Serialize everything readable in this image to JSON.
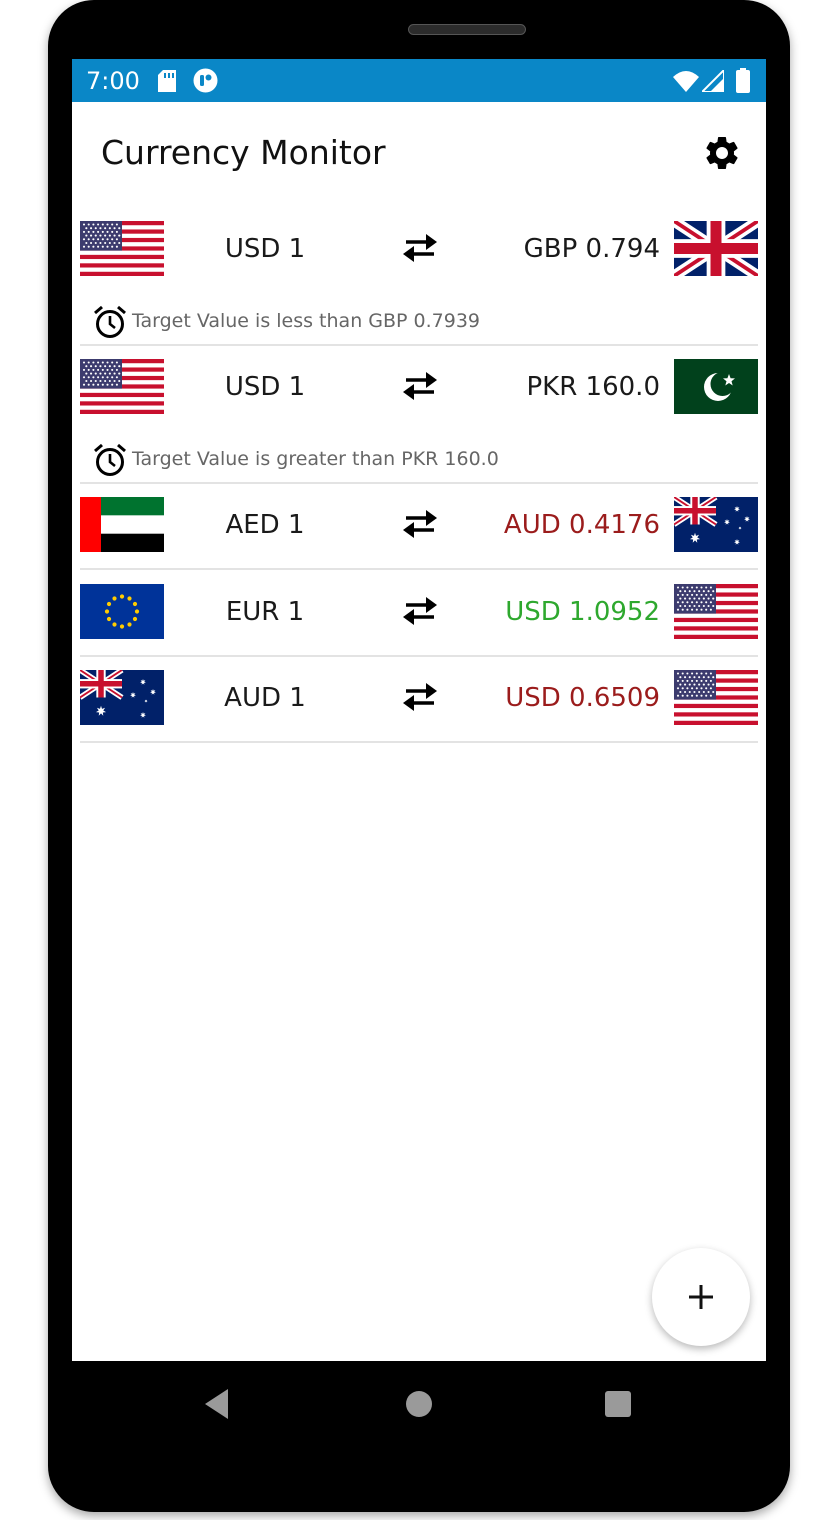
{
  "status_bar": {
    "time": "7:00"
  },
  "app_bar": {
    "title": "Currency Monitor"
  },
  "colors": {
    "status_bar": "#0a87c7",
    "rate_down": "#9b1c1c",
    "rate_up": "#2ea82e",
    "text": "#1a1a1a"
  },
  "pairs": [
    {
      "base": "USD 1",
      "quote": "GBP 0.794",
      "base_flag": "us-flag-icon",
      "quote_flag": "gb-flag-icon",
      "quote_color": "#1a1a1a",
      "alert": "Target Value  is less than GBP 0.7939"
    },
    {
      "base": "USD 1",
      "quote": "PKR 160.0",
      "base_flag": "us-flag-icon",
      "quote_flag": "pk-flag-icon",
      "quote_color": "#1a1a1a",
      "alert": "Target Value  is greater than PKR 160.0"
    },
    {
      "base": "AED 1",
      "quote": "AUD 0.4176",
      "base_flag": "ae-flag-icon",
      "quote_flag": "au-flag-icon",
      "quote_color": "#9b1c1c"
    },
    {
      "base": "EUR 1",
      "quote": "USD 1.0952",
      "base_flag": "eu-flag-icon",
      "quote_flag": "us-flag-icon",
      "quote_color": "#2ea82e"
    },
    {
      "base": "AUD 1",
      "quote": "USD 0.6509",
      "base_flag": "au-flag-icon",
      "quote_flag": "us-flag-icon",
      "quote_color": "#9b1c1c"
    }
  ],
  "fab": {
    "icon": "plus-icon",
    "label": "+"
  },
  "nav": {
    "back_icon": "back-icon",
    "home_icon": "home-icon",
    "recents_icon": "recents-icon"
  }
}
